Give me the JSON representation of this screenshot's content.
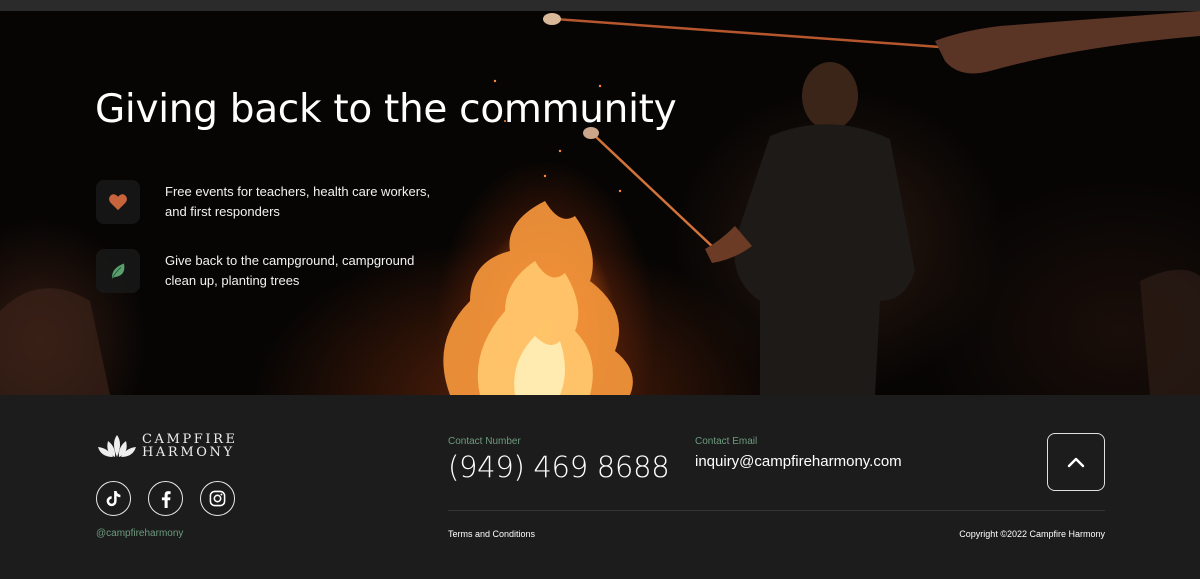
{
  "hero": {
    "title": "Giving back to the community",
    "features": [
      {
        "icon": "heart-icon",
        "icon_color": "#c8643c",
        "text": "Free events for teachers, health care workers, and first responders"
      },
      {
        "icon": "leaf-icon",
        "icon_color": "#5aa06e",
        "text": "Give back to the campground, campground clean up, planting trees"
      }
    ]
  },
  "footer": {
    "brand": {
      "line1": "CAMPFIRE",
      "line2": "HARMONY"
    },
    "socials": [
      {
        "name": "tiktok-icon"
      },
      {
        "name": "facebook-icon"
      },
      {
        "name": "instagram-icon"
      }
    ],
    "handle": "@campfireharmony",
    "contact_number_label": "Contact Number",
    "contact_number": "(949) 469 8688",
    "contact_email_label": "Contact Email",
    "contact_email": "inquiry@campfireharmony.com",
    "terms": "Terms and Conditions",
    "copyright": "Copyright ©2022 Campfire Harmony",
    "accent_color": "#6d9b7f"
  }
}
